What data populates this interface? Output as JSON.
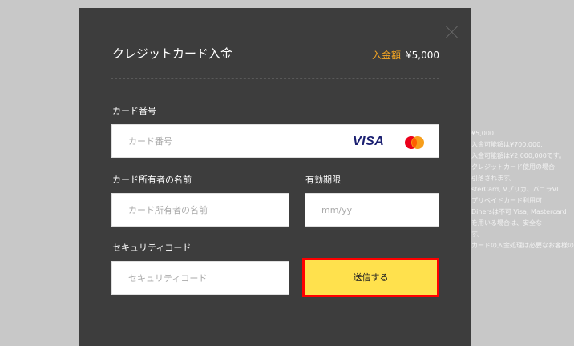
{
  "modal": {
    "title": "クレジットカード入金",
    "amount_label": "入金額",
    "amount_value": "¥5,000"
  },
  "form": {
    "card_number": {
      "label": "カード番号",
      "placeholder": "カード番号",
      "value": ""
    },
    "card_brands": {
      "visa": "VISA",
      "mastercard_icon": "mastercard-logo"
    },
    "cardholder_name": {
      "label": "カード所有者の名前",
      "placeholder": "カード所有者の名前",
      "value": ""
    },
    "expiry": {
      "label": "有効期限",
      "placeholder": "mm/yy",
      "value": ""
    },
    "security_code": {
      "label": "セキュリティコード",
      "placeholder": "セキュリティコード",
      "value": ""
    },
    "submit_label": "送信する"
  },
  "background_text": [
    "¥5,000.",
    "入金可能額は¥700,000.",
    "入金可能額は¥2,000,000です。",
    "クレジットカード使用の場合",
    "引落されます。",
    "sterCard, Vプリカ、バニラVI",
    "プリペイドカード利用可",
    "Dinersは不可 Visa, Mastercard",
    "を用いる場合は、安全な",
    "す。",
    "カードの入金処理は必要なお客様の"
  ],
  "colors": {
    "modal_bg": "#3d3d3d",
    "accent": "#f5a623",
    "button_bg": "#ffe14d",
    "highlight_border": "#ff0000"
  }
}
